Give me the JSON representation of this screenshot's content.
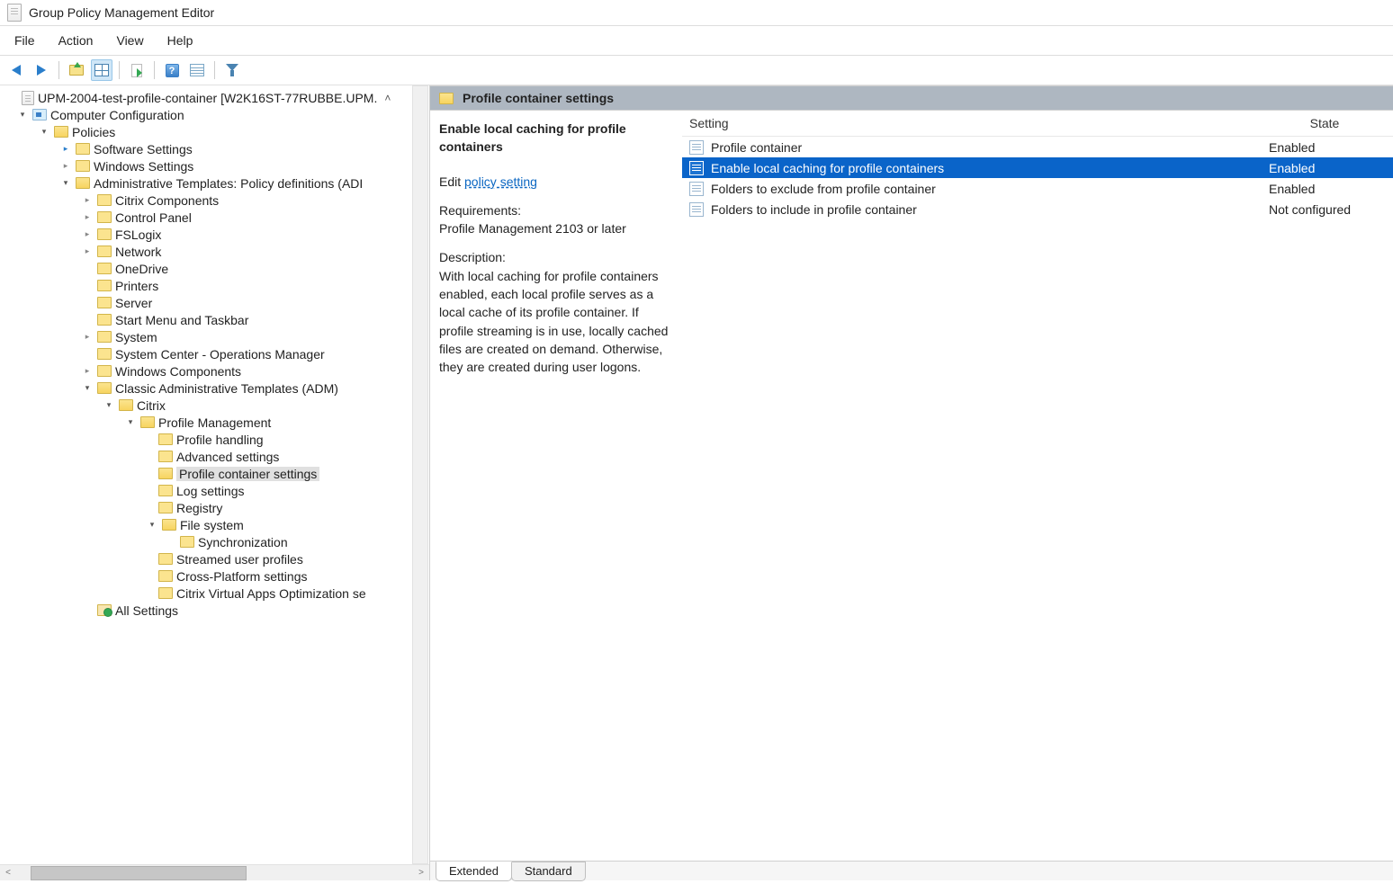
{
  "window": {
    "title": "Group Policy Management Editor"
  },
  "menu": {
    "file": "File",
    "action": "Action",
    "view": "View",
    "help": "Help"
  },
  "tree": {
    "root": "UPM-2004-test-profile-container [W2K16ST-77RUBBE.UPM.",
    "computer_configuration": "Computer Configuration",
    "policies": "Policies",
    "software_settings": "Software Settings",
    "windows_settings": "Windows Settings",
    "admin_templates": "Administrative Templates: Policy definitions (ADI",
    "citrix_components": "Citrix Components",
    "control_panel": "Control Panel",
    "fslogix": "FSLogix",
    "network": "Network",
    "onedrive": "OneDrive",
    "printers": "Printers",
    "server": "Server",
    "start_menu": "Start Menu and Taskbar",
    "system": "System",
    "scom": "System Center - Operations Manager",
    "windows_components": "Windows Components",
    "classic_adm": "Classic Administrative Templates (ADM)",
    "citrix": "Citrix",
    "profile_management": "Profile Management",
    "profile_handling": "Profile handling",
    "advanced_settings": "Advanced settings",
    "profile_container_settings": "Profile container settings",
    "log_settings": "Log settings",
    "registry": "Registry",
    "file_system": "File system",
    "synchronization": "Synchronization",
    "streamed_user_profiles": "Streamed user profiles",
    "cross_platform": "Cross-Platform settings",
    "cva_opt": "Citrix Virtual Apps Optimization se",
    "all_settings": "All Settings"
  },
  "right": {
    "header": "Profile container settings",
    "detail_title": "Enable local caching for profile containers",
    "edit_label": "Edit",
    "edit_link": "policy setting",
    "requirements_label": "Requirements:",
    "requirements_text": "Profile Management 2103 or later",
    "description_label": "Description:",
    "description_text": "With local caching for profile containers enabled, each local profile serves as a local cache of its profile container. If profile streaming is in use, locally cached files are created on demand. Otherwise, they are created during user logons.",
    "columns": {
      "setting": "Setting",
      "state": "State"
    },
    "rows": [
      {
        "label": "Profile container",
        "state": "Enabled",
        "selected": false
      },
      {
        "label": "Enable local caching for profile containers",
        "state": "Enabled",
        "selected": true
      },
      {
        "label": "Folders to exclude from profile container",
        "state": "Enabled",
        "selected": false
      },
      {
        "label": "Folders to include in profile container",
        "state": "Not configured",
        "selected": false
      }
    ]
  },
  "tabs": {
    "extended": "Extended",
    "standard": "Standard"
  }
}
